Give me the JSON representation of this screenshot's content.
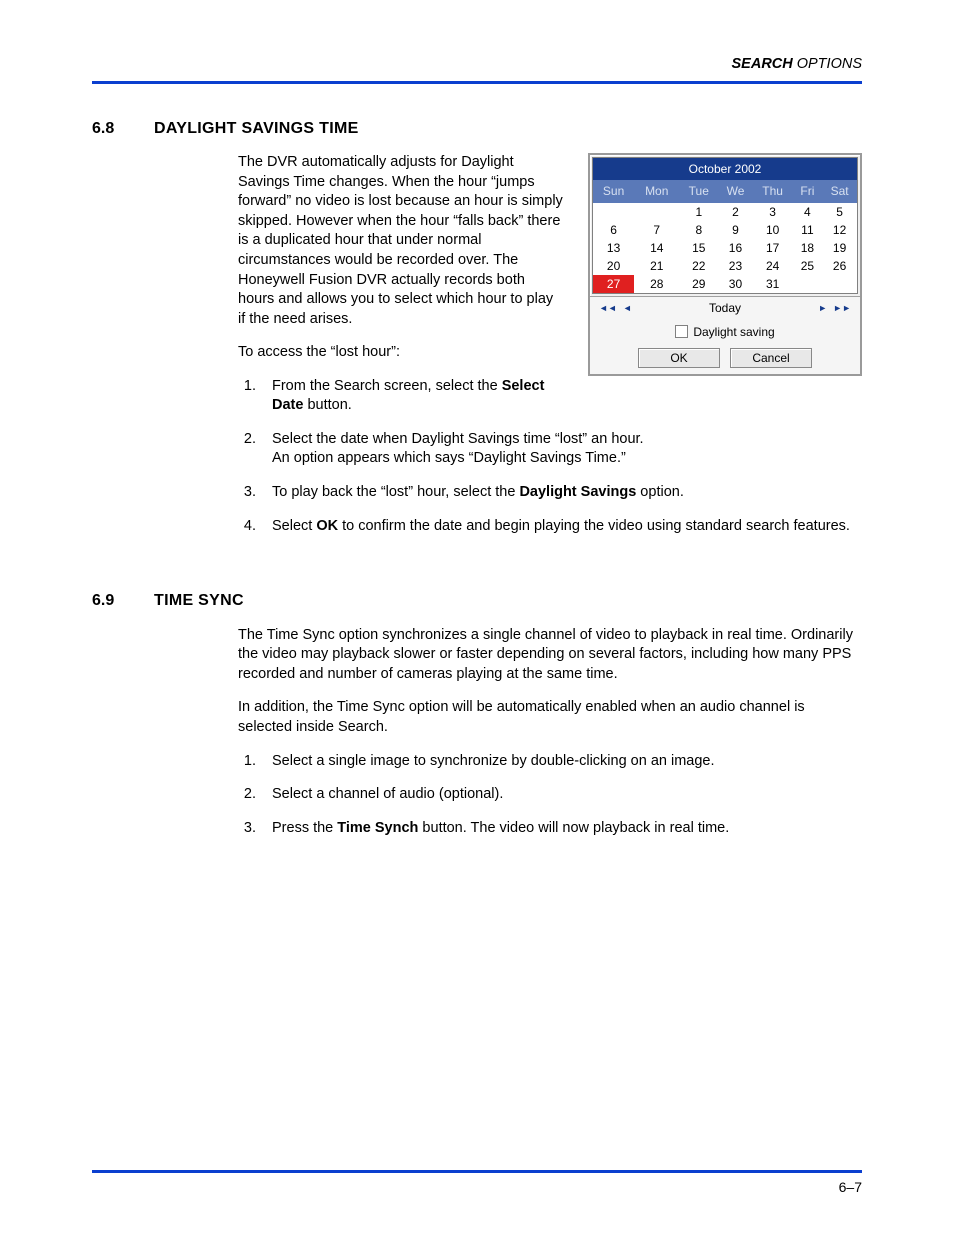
{
  "header": {
    "bold": "SEARCH",
    "rest": "OPTIONS"
  },
  "section1": {
    "num": "6.8",
    "title": "DAYLIGHT SAVINGS TIME",
    "para1": "The DVR automatically adjusts for Daylight Savings Time changes. When the hour “jumps forward” no video is lost because an hour is simply skipped. However when the hour “falls back” there is a duplicated hour that under normal circumstances would be recorded over. The Honeywell Fusion DVR actually records both hours and allows you to select which hour to play if the need arises.",
    "para2": "To access the “lost hour”:",
    "step1a": "From the Search screen, select the ",
    "step1b": "Select Date",
    "step1c": " button.",
    "step2a": "Select the date when Daylight Savings time “lost” an hour.",
    "step2b": "An option appears which says “Daylight Savings Time.”",
    "step3a": "To play back the “lost” hour, select the ",
    "step3b": "Daylight Savings",
    "step3c": " option.",
    "step4a": "Select ",
    "step4b": "OK",
    "step4c": " to confirm the date and begin playing the video using standard search features."
  },
  "calendar": {
    "title": "October 2002",
    "dow": [
      "Sun",
      "Mon",
      "Tue",
      "We",
      "Thu",
      "Fri",
      "Sat"
    ],
    "rows": [
      [
        "",
        "",
        "1",
        "2",
        "3",
        "4",
        "5"
      ],
      [
        "6",
        "7",
        "8",
        "9",
        "10",
        "11",
        "12"
      ],
      [
        "13",
        "14",
        "15",
        "16",
        "17",
        "18",
        "19"
      ],
      [
        "20",
        "21",
        "22",
        "23",
        "24",
        "25",
        "26"
      ],
      [
        "27",
        "28",
        "29",
        "30",
        "31",
        "",
        ""
      ]
    ],
    "selected": "27",
    "today": "Today",
    "dst_label": "Daylight saving",
    "ok": "OK",
    "cancel": "Cancel"
  },
  "section2": {
    "num": "6.9",
    "title": "TIME SYNC",
    "para1": "The Time Sync option synchronizes a single channel of video to playback in real time. Ordinarily the video may playback slower or faster depending on several factors, including how many PPS recorded and number of cameras playing at the same time.",
    "para2": "In addition, the Time Sync option will be automatically enabled when an audio channel is selected inside Search.",
    "step1": "Select a single image to synchronize by double-clicking on an image.",
    "step2": "Select a channel of audio (optional).",
    "step3a": "Press the ",
    "step3b": "Time Synch",
    "step3c": " button. The video will now playback in real time."
  },
  "footer": {
    "page": "6–7"
  }
}
